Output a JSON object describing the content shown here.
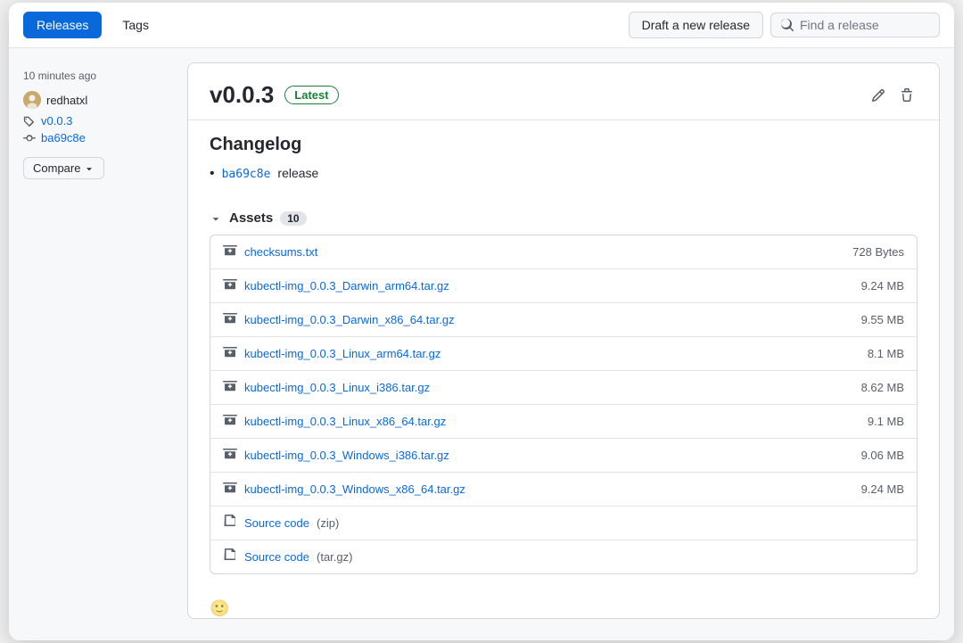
{
  "tabs": {
    "releases_label": "Releases",
    "tags_label": "Tags"
  },
  "header": {
    "draft_btn_label": "Draft a new release",
    "search_placeholder": "Find a release"
  },
  "sidebar": {
    "time_ago": "10 minutes ago",
    "username": "redhatxl",
    "tag": "v0.0.3",
    "commit": "ba69c8e",
    "compare_btn": "Compare"
  },
  "release": {
    "version": "v0.0.3",
    "badge": "Latest",
    "changelog_title": "Changelog",
    "changelog_commit": "ba69c8e",
    "changelog_text": " release",
    "assets_label": "Assets",
    "assets_count": "10",
    "assets": [
      {
        "name": "checksums.txt",
        "size": "728 Bytes",
        "type": "file"
      },
      {
        "name": "kubectl-img_0.0.3_Darwin_arm64.tar.gz",
        "size": "9.24 MB",
        "type": "archive"
      },
      {
        "name": "kubectl-img_0.0.3_Darwin_x86_64.tar.gz",
        "size": "9.55 MB",
        "type": "archive"
      },
      {
        "name": "kubectl-img_0.0.3_Linux_arm64.tar.gz",
        "size": "8.1 MB",
        "type": "archive"
      },
      {
        "name": "kubectl-img_0.0.3_Linux_i386.tar.gz",
        "size": "8.62 MB",
        "type": "archive"
      },
      {
        "name": "kubectl-img_0.0.3_Linux_x86_64.tar.gz",
        "size": "9.1 MB",
        "type": "archive"
      },
      {
        "name": "kubectl-img_0.0.3_Windows_i386.tar.gz",
        "size": "9.06 MB",
        "type": "archive"
      },
      {
        "name": "kubectl-img_0.0.3_Windows_x86_64.tar.gz",
        "size": "9.24 MB",
        "type": "archive"
      },
      {
        "name": "Source code",
        "extra": "(zip)",
        "size": "",
        "type": "source"
      },
      {
        "name": "Source code",
        "extra": "(tar.gz)",
        "size": "",
        "type": "source"
      }
    ]
  }
}
